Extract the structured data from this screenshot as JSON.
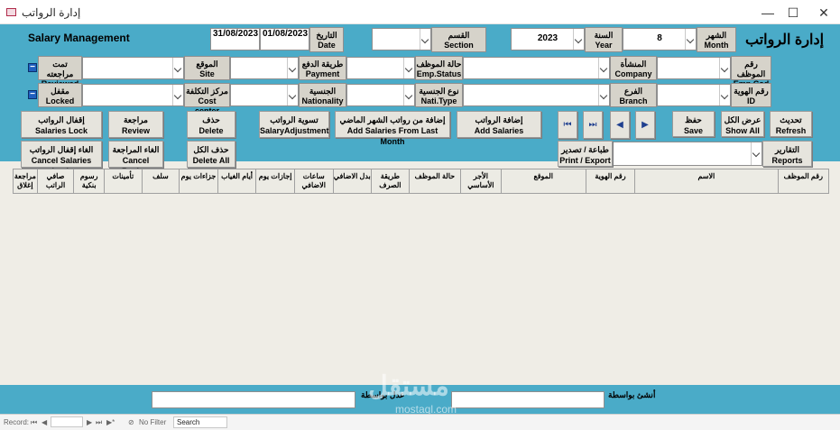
{
  "window": {
    "title": "إدارة الرواتب",
    "minimize": "—",
    "maximize": "☐",
    "close": "✕"
  },
  "form": {
    "title_ar": "إدارة الرواتب",
    "title_en": "Salary Management"
  },
  "filters_row1": {
    "month": {
      "label_ar": "الشهر",
      "label_en": "Month",
      "value": "8"
    },
    "year": {
      "label_ar": "السنة",
      "label_en": "Year",
      "value": "2023"
    },
    "section": {
      "label_ar": "القسم",
      "label_en": "Section",
      "value": ""
    },
    "date": {
      "label_ar": "التاريخ",
      "label_en": "Date",
      "from": "01/08/2023",
      "to": "31/08/2023"
    }
  },
  "filters_row2": {
    "emp_code": {
      "label_ar": "رقم الموظف",
      "label_en": "Emp.Cod"
    },
    "company": {
      "label_ar": "المنشأة",
      "label_en": "Company"
    },
    "emp_status": {
      "label_ar": "حالة الموظف",
      "label_en": "Emp.Status"
    },
    "payment": {
      "label_ar": "طريقة الدفع",
      "label_en": "Payment"
    },
    "site": {
      "label_ar": "الموقع",
      "label_en": "Site"
    },
    "reviewed": {
      "label_ar": "تمت مراجعته",
      "label_en": "Reviewed"
    }
  },
  "filters_row3": {
    "id": {
      "label_ar": "رقم الهوية",
      "label_en": "ID"
    },
    "branch": {
      "label_ar": "الفرع",
      "label_en": "Branch"
    },
    "nati_type": {
      "label_ar": "نوع الجنسية",
      "label_en": "Nati.Type"
    },
    "nationality": {
      "label_ar": "الجنسية",
      "label_en": "Nationality"
    },
    "cost_center": {
      "label_ar": "مركز التكلفة",
      "label_en": "Cost center"
    },
    "locked": {
      "label_ar": "مقفل",
      "label_en": "Locked"
    }
  },
  "buttons": {
    "refresh": {
      "ar": "تحديث",
      "en": "Refresh"
    },
    "show_all": {
      "ar": "عرض الكل",
      "en": "Show All"
    },
    "save": {
      "ar": "حفظ",
      "en": "Save"
    },
    "reports": {
      "ar": "التقارير",
      "en": "Reports"
    },
    "print_export": {
      "ar": "طباعة / تصدير",
      "en": "Print / Export"
    },
    "add_salaries": {
      "ar": "إضافة الرواتب",
      "en": "Add Salaries"
    },
    "add_last_month": {
      "ar": "إضافة من رواتب الشهر الماضي",
      "en": "Add Salaries From Last Month"
    },
    "salary_adjustment": {
      "ar": "تسوية الرواتب",
      "en": "SalaryAdjustment"
    },
    "delete": {
      "ar": "حذف",
      "en": "Delete"
    },
    "delete_all": {
      "ar": "حذف الكل",
      "en": "Delete All"
    },
    "review": {
      "ar": "مراجعة",
      "en": "Review"
    },
    "cancel_review": {
      "ar": "الغاء المراجعة",
      "en": "Cancel Review"
    },
    "salaries_lock": {
      "ar": "إقفال الرواتب",
      "en": "Salaries Lock"
    },
    "cancel_salaries_lock": {
      "ar": "الغاء إقفال الرواتب",
      "en": "Cancel Salaries Lock"
    },
    "nav_first": "⏮",
    "nav_last": "⏭",
    "nav_prev": "◀",
    "nav_next": "▶",
    "collapse": "−"
  },
  "grid_columns": [
    "مراجعة إغلاق",
    "صافي الراتب",
    "رسوم بنكية",
    "تأمينات",
    "سلف",
    "جزاءات يوم",
    "أيام الغياب",
    "إجازات يوم",
    "ساعات الاضافي",
    "بدل الاضافي",
    "طريقة الصرف",
    "حالة الموظف",
    "الأجر الأساسي",
    "الموقع",
    "رقم الهوية",
    "الاسم",
    "رقم الموظف"
  ],
  "footer": {
    "created_by": "أنشئ بواسطة",
    "edited_by": "عدل بواسطة"
  },
  "watermark": {
    "main": "مستقل",
    "sub": "mostaql.com"
  },
  "statusbar": {
    "record_label": "Record:",
    "first": "⏮",
    "prev": "◀",
    "next": "▶",
    "last": "⏭",
    "new": "▶*",
    "no_filter": "No Filter",
    "search": "Search"
  }
}
